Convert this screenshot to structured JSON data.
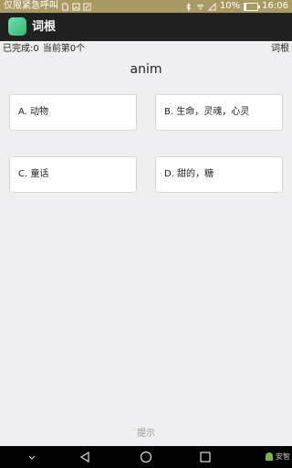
{
  "status_bar": {
    "carrier_text": "仅限紧急呼叫",
    "battery_text": "10%",
    "battery_level": 0.1,
    "time": "16:06"
  },
  "app_bar": {
    "title": "词根"
  },
  "progress": {
    "completed": "已完成:0",
    "current": "当前第0个",
    "right_label": "词根"
  },
  "question": {
    "word": "anim"
  },
  "options": [
    {
      "label": "A. 动物"
    },
    {
      "label": "B. 生命，灵魂，心灵"
    },
    {
      "label": "C. 童话"
    },
    {
      "label": "D. 甜的，糖"
    }
  ],
  "hint_label": "提示",
  "nav_bar": {
    "corner_text": "安智"
  },
  "colors": {
    "status_bar": "#a99a63",
    "app_bar": "#212121",
    "background": "#efeff1",
    "app_icon": "#4fcf92"
  }
}
